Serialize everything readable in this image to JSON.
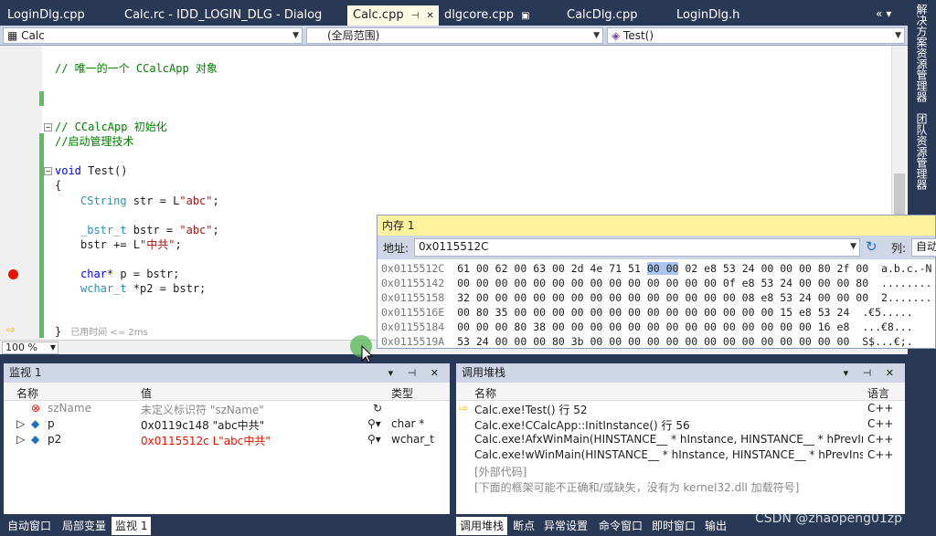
{
  "tabs": [
    {
      "label": "LoginDlg.cpp"
    },
    {
      "label": "Calc.rc - IDD_LOGIN_DLG - Dialog"
    },
    {
      "label": "Calc.cpp",
      "pin": "⊣",
      "close": "✕"
    },
    {
      "label": "dlgcore.cpp",
      "lock": "🔒"
    },
    {
      "label": "CalcDlg.cpp"
    },
    {
      "label": "LoginDlg.h"
    }
  ],
  "tab_controls": "«▾",
  "nav": {
    "project": "Calc",
    "scope": "(全局范围)",
    "member": "Test()"
  },
  "code": {
    "l1": "// 唯一的一个 CCalcApp 对象",
    "l2": "// CCalcApp 初始化",
    "l3": "//启动管理技术",
    "l4_kw": "void",
    "l4_rest": " Test()",
    "l5": "{",
    "l6_ty": "CString",
    "l6_a": " str = L",
    "l6_s": "\"abc\"",
    "l6_b": ";",
    "l7_ty": "_bstr_t",
    "l7_a": " bstr = ",
    "l7_s": "\"abc\"",
    "l7_b": ";",
    "l8_a": "bstr += L",
    "l8_s": "\"中共\"",
    "l8_b": ";",
    "l9_kw": "char",
    "l9_a": "* p = bstr;",
    "l10_ty": "wchar_t",
    "l10_a": " *p2 = bstr;",
    "l11": "}",
    "elapsed": "已用时间 <= 2ms"
  },
  "zoom": "100 %",
  "memory": {
    "title": "内存 1",
    "addr_label": "地址:",
    "addr_value": "0x0115512C",
    "col_label": "列:",
    "col_value": "自动",
    "rows": [
      {
        "addr": "0x0115512C",
        "bytes_pre": "61 00 62 00 63 00 2d 4e 71 51 ",
        "bytes_hl": "00 00",
        "bytes_post": " 02 e8 53 24 00 00 00 80 2f 00",
        "ascii": "a.b.c.-N"
      },
      {
        "addr": "0x01155142",
        "bytes_pre": "00 00 00 00 00 00 00 00 00 00 00 00 00 00 0f e8 53 24 00 00 00 80",
        "bytes_hl": "",
        "bytes_post": "",
        "ascii": "........"
      },
      {
        "addr": "0x01155158",
        "bytes_pre": "32 00 00 00 00 00 00 00 00 00 00 00 00 00 00 08 e8 53 24 00 00 00",
        "bytes_hl": "",
        "bytes_post": "",
        "ascii": "2......."
      },
      {
        "addr": "0x0115516E",
        "bytes_pre": "00 80 35 00 00 00 00 00 00 00 00 00 00 00 00 00 00 15 e8 53 24",
        "bytes_hl": "",
        "bytes_post": "",
        "ascii": ".€5....."
      },
      {
        "addr": "0x01155184",
        "bytes_pre": "00 00 00 80 38 00 00 00 00 00 00 00 00 00 00 00 00 00 00 16 e8",
        "bytes_hl": "",
        "bytes_post": "",
        "ascii": "...€8..."
      },
      {
        "addr": "0x0115519A",
        "bytes_pre": "53 24 00 00 00 80 3b 00 00 00 00 00 00 00 00 00 00 00 00 00 00",
        "bytes_hl": "",
        "bytes_post": "",
        "ascii": "S$...€;."
      }
    ]
  },
  "watch": {
    "title": "监视 1",
    "cols": {
      "name": "名称",
      "value": "值",
      "type": "类型"
    },
    "rows": [
      {
        "name": "szName",
        "value": "未定义标识符 \"szName\"",
        "type": ""
      },
      {
        "name": "p",
        "value": "0x0119c148 \"abc中共\"",
        "type": "char *"
      },
      {
        "name": "p2",
        "value": "0x0115512c L\"abc中共\"",
        "type": "wchar_t"
      }
    ],
    "tabs": [
      "自动窗口",
      "局部变量",
      "监视 1"
    ]
  },
  "callstack": {
    "title": "调用堆栈",
    "cols": {
      "name": "名称",
      "lang": "语言"
    },
    "rows": [
      {
        "name": "Calc.exe!Test() 行 52",
        "lang": "C++"
      },
      {
        "name": "Calc.exe!CCalcApp::InitInstance() 行 56",
        "lang": "C++"
      },
      {
        "name": "Calc.exe!AfxWinMain(HINSTANCE__ * hInstance, HINSTANCE__ * hPrevInstance, wchar",
        "lang": "C++"
      },
      {
        "name": "Calc.exe!wWinMain(HINSTANCE__ * hInstance, HINSTANCE__ * hPrevInstance, w",
        "lang": "C++"
      },
      {
        "name": "[外部代码]",
        "lang": ""
      },
      {
        "name": "[下面的框架可能不正确和/或缺失，没有为 kernel32.dll 加载符号]",
        "lang": ""
      }
    ],
    "tabs": [
      "调用堆栈",
      "断点",
      "异常设置",
      "命令窗口",
      "即时窗口",
      "输出"
    ]
  },
  "side": {
    "solution_explorer": "解决方案资源管理器",
    "team_explorer": "团队资源管理器"
  },
  "watermark": "CSDN @zhaopeng01zp",
  "colors": {
    "accent": "#293955",
    "highlight": "#fff29d",
    "breakpoint": "#e51400",
    "changebar": "#5cc05c"
  }
}
